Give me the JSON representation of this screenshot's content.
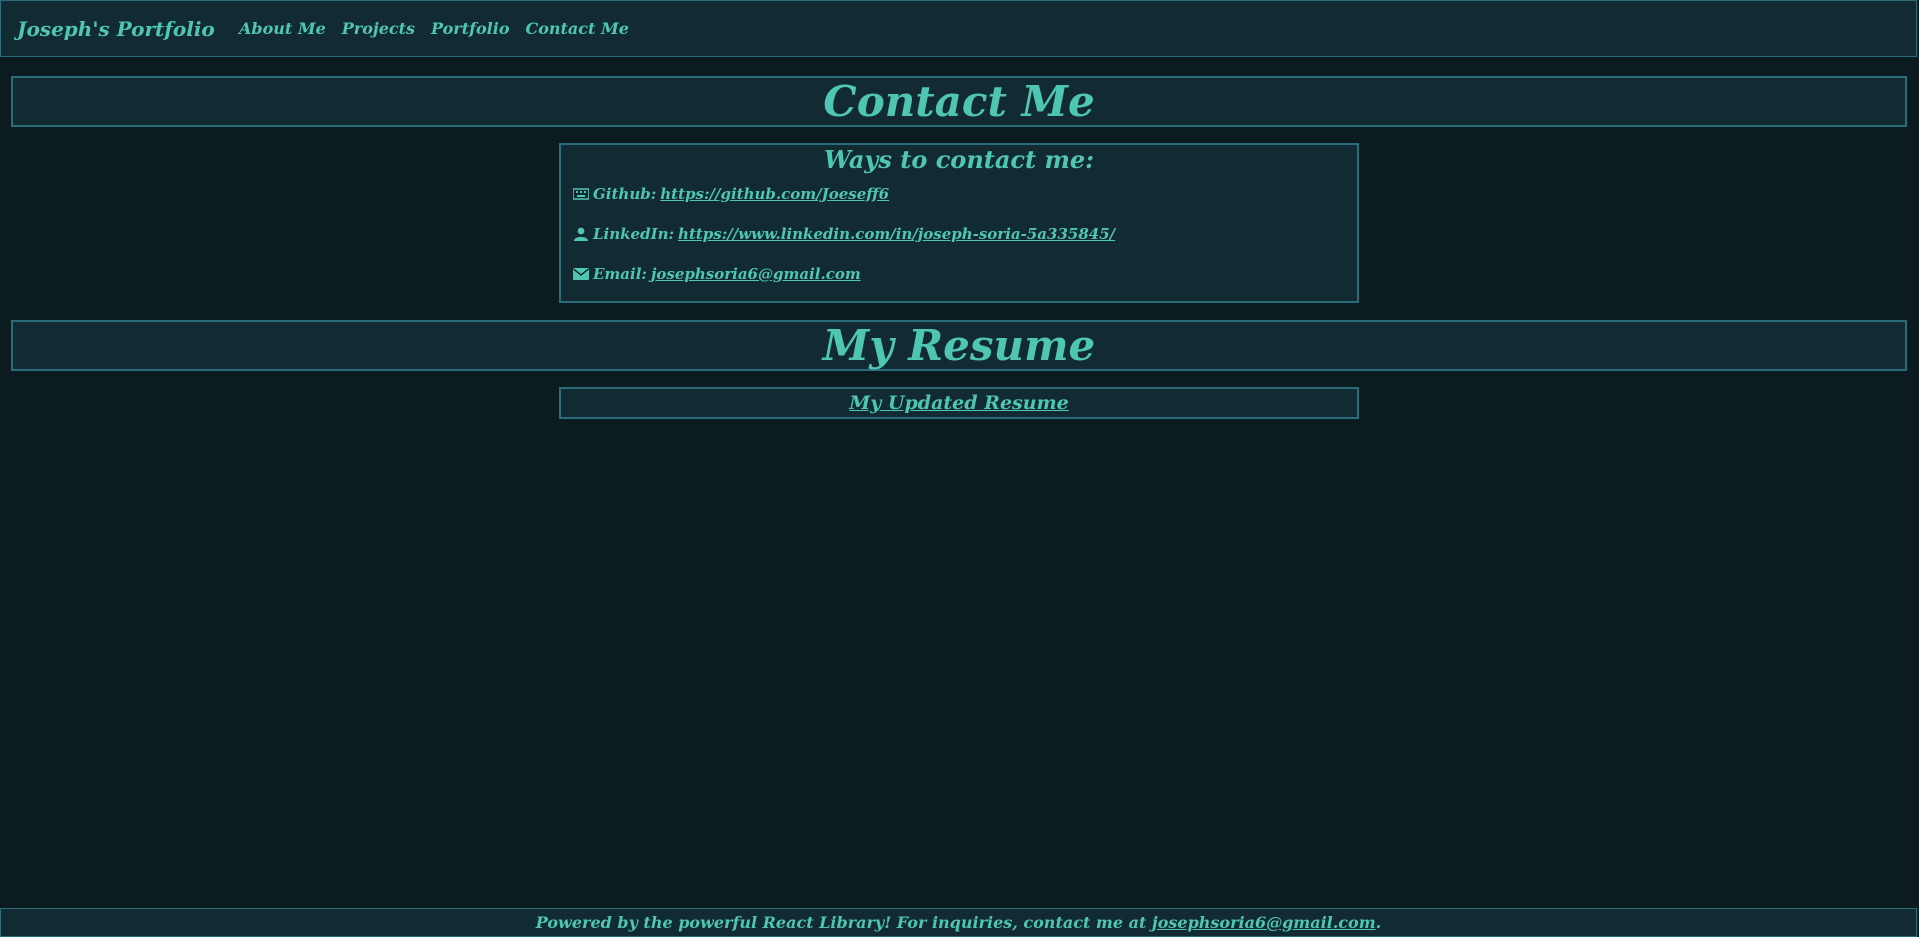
{
  "navbar": {
    "brand": "Joseph's Portfolio",
    "links": [
      "About Me",
      "Projects",
      "Portfolio",
      "Contact Me"
    ]
  },
  "contact": {
    "heading": "Contact Me",
    "box_title": "Ways to contact me:",
    "items": [
      {
        "icon": "keyboard-icon",
        "label": "Github:",
        "link": " https://github.com/Joeseff6"
      },
      {
        "icon": "user-icon",
        "label": "LinkedIn:",
        "link": " https://www.linkedin.com/in/joseph-soria-5a335845/"
      },
      {
        "icon": "envelope-icon",
        "label": "Email:",
        "link": "josephsoria6@gmail.com"
      }
    ]
  },
  "resume": {
    "heading": "My Resume",
    "link": "My Updated Resume"
  },
  "footer": {
    "text": "Powered by the powerful React Library! For inquiries, contact me at",
    "email": "josephsoria6@gmail.com",
    "end": "."
  },
  "colors": {
    "background": "#0b1b20",
    "panel": "#122b33",
    "border": "#2a6d7a",
    "accent": "#4fc6b4"
  }
}
